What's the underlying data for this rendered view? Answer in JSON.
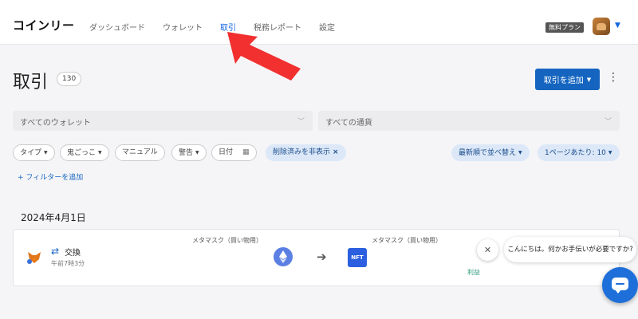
{
  "app": {
    "logo": "コインリー"
  },
  "nav": {
    "items": [
      "ダッシュボード",
      "ウォレット",
      "取引",
      "税務レポート",
      "設定"
    ],
    "active": "取引"
  },
  "header": {
    "plan_badge": "無料プラン"
  },
  "page": {
    "title": "取引",
    "count": "130"
  },
  "actions": {
    "add_transaction": "取引を追加"
  },
  "filters": {
    "wallet_select": "すべてのウォレット",
    "currency_select": "すべての通貨",
    "chips": {
      "type": "タイプ",
      "tag": "鬼ごっこ",
      "manual": "マニュアル",
      "warning": "警告",
      "date": "日付",
      "hide_deleted": "削除済みを非表示",
      "sort": "最新順で並べ替え",
      "per_page": "1ページあたり: 10"
    },
    "add_filter": "+ フィルターを追加"
  },
  "transactions": {
    "date": "2024年4月1日",
    "item": {
      "type_label": "交換",
      "time": "午前7時3分",
      "from_wallet": "メタマスク（買い物用）",
      "to_wallet": "メタマスク（買い物用）",
      "to_asset": "NFT",
      "tag": "利益"
    }
  },
  "chat": {
    "greeting": "こんにちは。何かお手伝いが必要ですか?"
  },
  "colors": {
    "accent": "#1565c0",
    "nav_active": "#1565e0",
    "annotation_arrow": "#f23030"
  }
}
